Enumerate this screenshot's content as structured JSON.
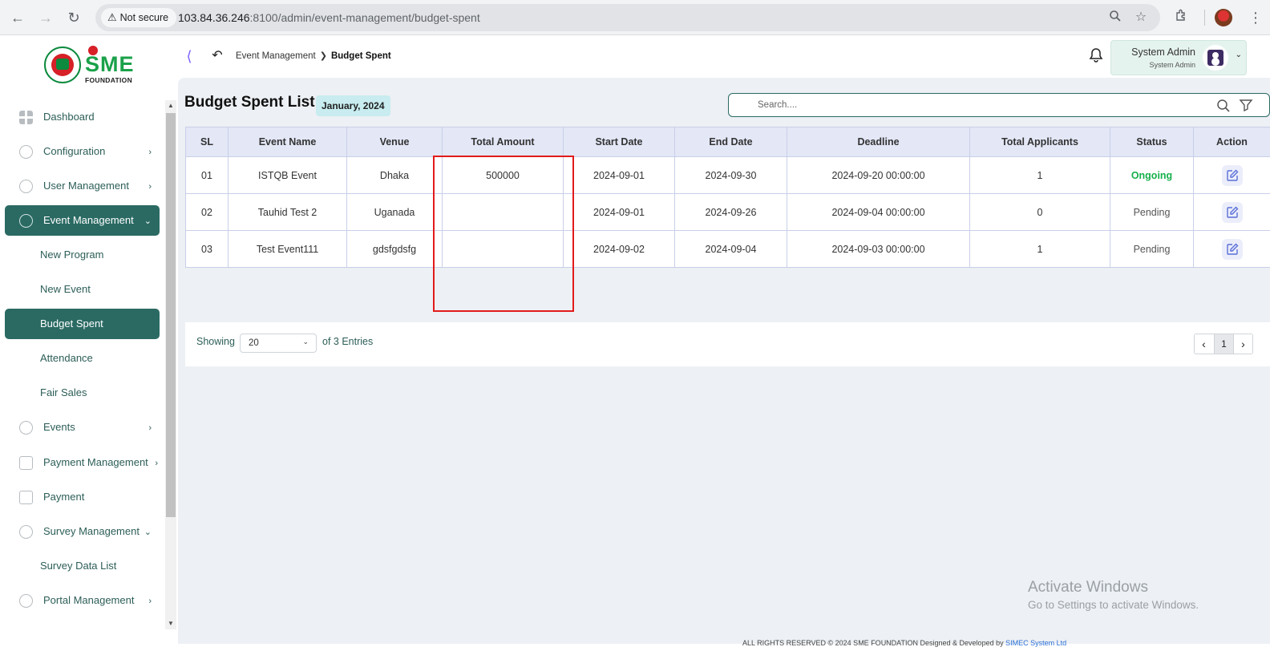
{
  "browser": {
    "security_label": "Not secure",
    "url_host": "103.84.36.246",
    "url_rest": ":8100/admin/event-management/budget-spent",
    "icons": [
      "back-icon",
      "forward-icon",
      "reload-icon",
      "zoom-icon",
      "star-icon",
      "extensions-icon",
      "profile-avatar",
      "more-icon"
    ]
  },
  "logo": {
    "brand_text": "SME",
    "brand_sub": "FOUNDATION"
  },
  "sidebar": {
    "items": [
      {
        "label": "Dashboard",
        "icon": "grid-icon",
        "arrow": ""
      },
      {
        "label": "Configuration",
        "icon": "cog-icon",
        "arrow": "›"
      },
      {
        "label": "User Management",
        "icon": "user-icon",
        "arrow": "›"
      },
      {
        "label": "Event Management",
        "icon": "lock-icon",
        "arrow": "⌄",
        "active": true
      },
      {
        "label": "New Program",
        "sub": true
      },
      {
        "label": "New Event",
        "sub": true
      },
      {
        "label": "Budget Spent",
        "sub": true,
        "active": true
      },
      {
        "label": "Attendance",
        "sub": true
      },
      {
        "label": "Fair Sales",
        "sub": true
      },
      {
        "label": "Events",
        "icon": "lock-icon",
        "arrow": "›"
      },
      {
        "label": "Payment Management",
        "icon": "money-icon",
        "arrow": "›"
      },
      {
        "label": "Payment",
        "icon": "money-icon",
        "arrow": ""
      },
      {
        "label": "Survey Management",
        "icon": "pie-icon",
        "arrow": "⌄"
      },
      {
        "label": "Survey Data List",
        "sub": true
      },
      {
        "label": "Portal Management",
        "icon": "lock-icon",
        "arrow": "›"
      }
    ]
  },
  "topbar": {
    "breadcrumb_parent": "Event Management",
    "breadcrumb_current": "Budget Spent",
    "user_name": "System Admin",
    "user_role": "System Admin"
  },
  "page": {
    "title": "Budget Spent List",
    "date_chip": "January, 2024",
    "search_placeholder": "Search...."
  },
  "table": {
    "columns": [
      "SL",
      "Event Name",
      "Venue",
      "Total Amount",
      "Start Date",
      "End Date",
      "Deadline",
      "Total Applicants",
      "Status",
      "Action"
    ],
    "rows": [
      {
        "sl": "01",
        "event_name": "ISTQB Event",
        "venue": "Dhaka",
        "total_amount": "500000",
        "start_date": "2024-09-01",
        "end_date": "2024-09-30",
        "deadline": "2024-09-20 00:00:00",
        "total_applicants": "1",
        "status": "Ongoing"
      },
      {
        "sl": "02",
        "event_name": "Tauhid Test 2",
        "venue": "Uganada",
        "total_amount": "",
        "start_date": "2024-09-01",
        "end_date": "2024-09-26",
        "deadline": "2024-09-04 00:00:00",
        "total_applicants": "0",
        "status": "Pending"
      },
      {
        "sl": "03",
        "event_name": "Test Event111",
        "venue": "gdsfgdsfg",
        "total_amount": "",
        "start_date": "2024-09-02",
        "end_date": "2024-09-04",
        "deadline": "2024-09-03 00:00:00",
        "total_applicants": "1",
        "status": "Pending"
      }
    ]
  },
  "pagination": {
    "showing_label": "Showing",
    "page_size": "20",
    "entries_label": "of 3 Entries",
    "current_page": "1"
  },
  "watermark": {
    "title": "Activate Windows",
    "subtitle": "Go to Settings to activate Windows."
  },
  "footer": {
    "copyright": "ALL RIGHTS RESERVED © 2024 SME FOUNDATION   Designed & Developed by",
    "developer": "SIMEC System Ltd"
  },
  "colors": {
    "primary": "#2a6a63",
    "status_ongoing": "#18b04c",
    "highlight": "#e21b1b",
    "header_bg": "#e3e7f6"
  }
}
